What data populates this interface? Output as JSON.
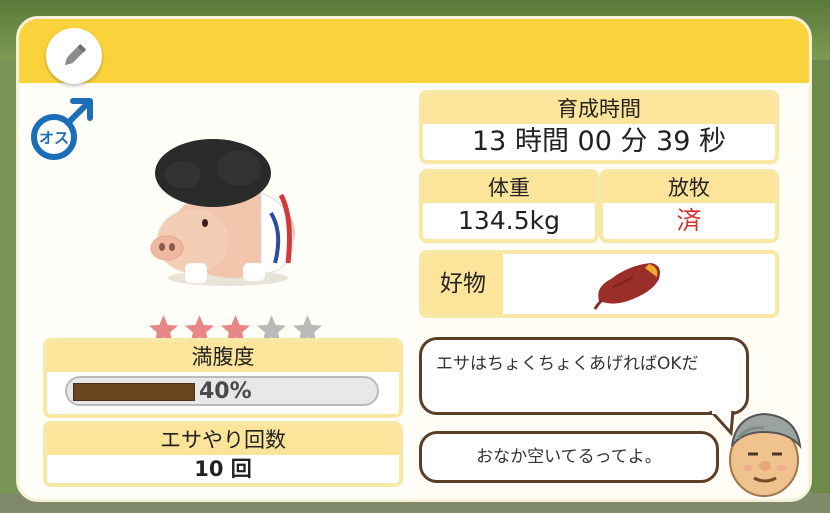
{
  "gender": {
    "label": "オス",
    "color": "#1a6fb8"
  },
  "rating": {
    "stars_filled": 3,
    "stars_total": 5,
    "filled_color": "#e98686",
    "empty_color": "#b9b9b9"
  },
  "fullness": {
    "label": "満腹度",
    "value": 0.4,
    "text": "40%"
  },
  "feed_count": {
    "label": "エサやり回数",
    "value": "10 回"
  },
  "growth_time": {
    "label": "育成時間",
    "value": "13 時間 00 分 39 秒"
  },
  "weight": {
    "label": "体重",
    "value": "134.5kg"
  },
  "grazing": {
    "label": "放牧",
    "value": "済",
    "value_color": "#d93030"
  },
  "favorite": {
    "label": "好物",
    "icon": "sweet-potato-icon"
  },
  "dialog": {
    "tip": "エサはちょくちょくあげればOKだ",
    "status": "おなか空いてるってよ。"
  },
  "colors": {
    "header": "#fad23c",
    "label_bg": "#fce59b",
    "border": "#f7e8a6"
  }
}
